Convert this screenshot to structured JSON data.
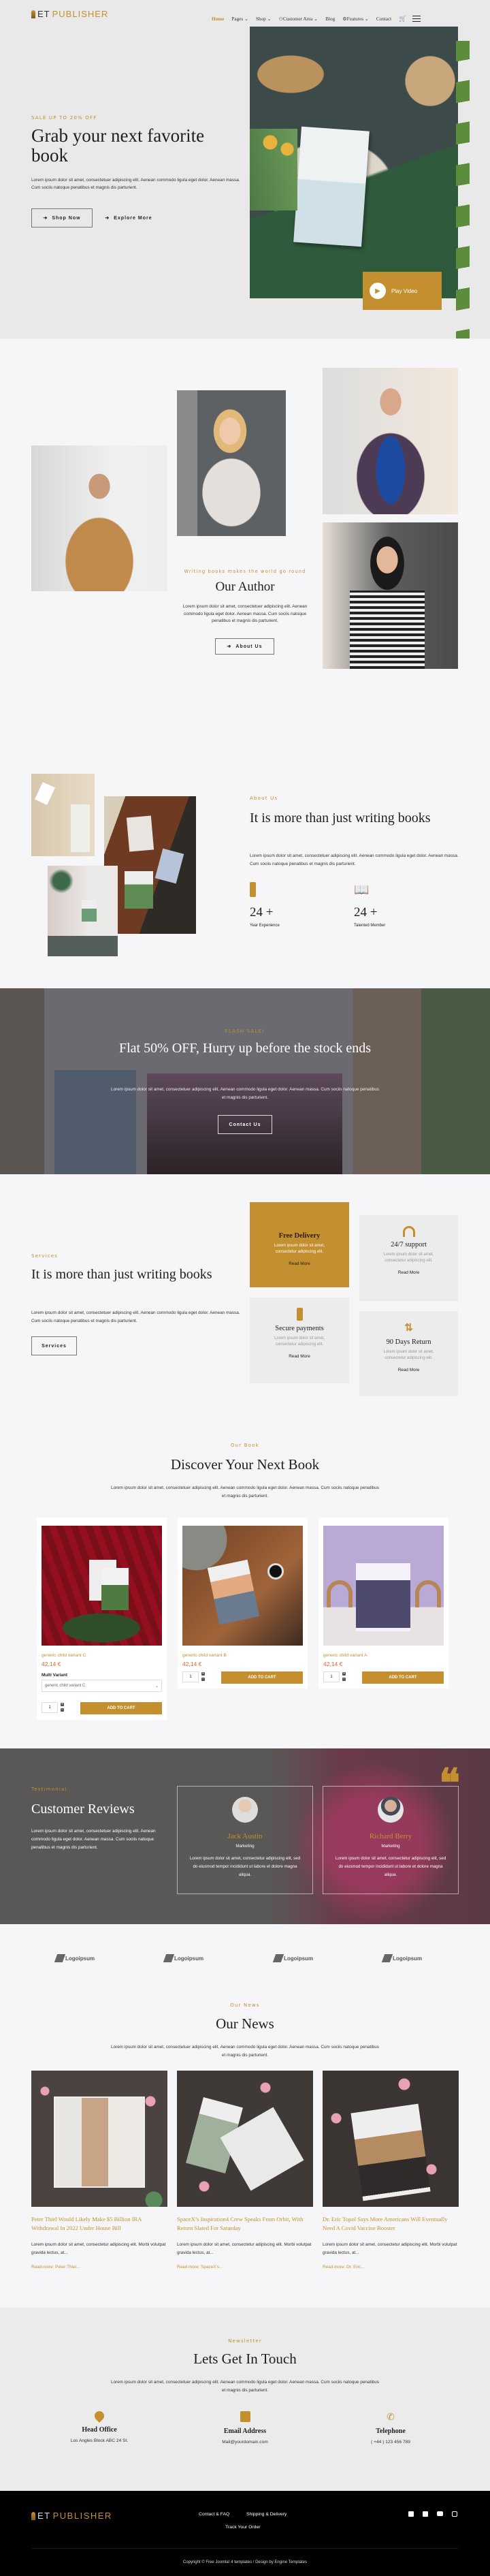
{
  "brand": {
    "logo_prefix": "ET",
    "logo_name": "PUBLISHER",
    "accent": "#c48f2f"
  },
  "nav": {
    "items": [
      {
        "label": "Home",
        "active": true
      },
      {
        "label": "Pages",
        "dropdown": true
      },
      {
        "label": "Shop",
        "dropdown": true
      },
      {
        "label": "Customer Area",
        "dropdown": true,
        "icon": "user-icon"
      },
      {
        "label": "Blog"
      },
      {
        "label": "Features",
        "dropdown": true,
        "icon": "gear-icon"
      },
      {
        "label": "Contact"
      }
    ],
    "cart_icon": "cart-icon",
    "menu_icon": "hamburger-icon"
  },
  "hero": {
    "eyebrow": "SALE UP TO 20% OFF",
    "title": "Grab your next favorite book",
    "text": "Lorem ipsum dolor sit amet, consectetuer adipiscing elit. Aenean commodo ligula eget dolor. Aenean massa. Cum sociis natoque penatibus et magnis dis parturient.",
    "primary_button": "Shop Now",
    "secondary_button": "Explore More",
    "video_button": "Play Video"
  },
  "authors": {
    "eyebrow": "Writing books makes the world go round",
    "title": "Our Author",
    "text": "Lorem ipsum dolor sit amet, consectetuer adipiscing elit. Aenean commodo ligula eget dolor. Aenean massa. Cum sociis natoque penatibus et magnis dis parturient.",
    "button": "About Us"
  },
  "about": {
    "eyebrow": "About Us",
    "title": "It is more than just writing books",
    "text": "Lorem ipsum dolor sit amet, consectetuer adipiscing elit. Aenean commodo ligula eget dolor. Aenean massa. Cum sociis natoque penatibus et magnis dis parturient.",
    "stats": [
      {
        "value": "24 +",
        "label": "Year Experience",
        "icon": "id-badge-icon"
      },
      {
        "value": "24 +",
        "label": "Talented Member",
        "icon": "reader-icon"
      }
    ]
  },
  "flash": {
    "eyebrow": "FLASH SALE!",
    "title": "Flat 50% OFF, Hurry up before the stock ends",
    "text": "Lorem ipsum dolor sit amet, consectetuer adipiscing elit. Aenean commodo ligula eget dolor. Aenean massa. Cum sociis natoque penatibus et magnis dis parturient.",
    "button": "Contact Us"
  },
  "services": {
    "eyebrow": "Services",
    "title": "It is more than just writing books",
    "text": "Lorem ipsum dolor sit amet, consectetuer adipiscing elit. Aenean commodo ligula eget dolor. Aenean massa. Cum sociis natoque penatibus et magnis dis parturient.",
    "button": "Services",
    "cards": [
      {
        "title": "Free Delivery",
        "text": "Lorem ipsum dolor sit amet, consectetur adipiscing elit.",
        "link": "Read More",
        "icon": "truck-icon"
      },
      {
        "title": "24/7 support",
        "text": "Lorem ipsum dolor sit amet, consectetur adipiscing elit.",
        "link": "Read More",
        "icon": "headphones-icon"
      },
      {
        "title": "Secure payments",
        "text": "Lorem ipsum dolor sit amet, consectetur adipiscing elit.",
        "link": "Read More",
        "icon": "phone-icon"
      },
      {
        "title": "90 Days Return",
        "text": "Lorem ipsum dolor sit amet, consectetur adipiscing elit.",
        "link": "Read More",
        "icon": "retweet-icon"
      }
    ]
  },
  "books": {
    "eyebrow": "Our Book",
    "title": "Discover Your Next Book",
    "text": "Lorem ipsum dolor sit amet, consectetuer adipiscing elit. Aenean commodo ligula eget dolor. Aenean massa. Cum sociis natoque penatibus et magnis dis parturient.",
    "products": [
      {
        "name": "generic child variant C",
        "price": "42,14 €",
        "variant_label": "Multi Variant",
        "variant_value": "generic child variant C",
        "qty": "1",
        "button": "ADD TO CART"
      },
      {
        "name": "generic child variant B",
        "price": "42,14 €",
        "qty": "1",
        "button": "ADD TO CART"
      },
      {
        "name": "generic child variant A",
        "price": "42,14 €",
        "qty": "1",
        "button": "ADD TO CART"
      }
    ]
  },
  "testimonials": {
    "eyebrow": "Testimonial",
    "title": "Customer Reviews",
    "text": "Lorem ipsum dolor sit amet, consectetuer adipiscing elit. Aenean commodo ligula eget dolor. Aenean massa. Cum sociis natoque penatibus et magnis dis parturient.",
    "items": [
      {
        "name": "Jack Austin",
        "role": "Marketing",
        "text": "Lorem ipsum dolor sit amet, consectetur adipiscing elit, sed do eiusmod tempor incididunt ut labore et dolore magna aliqua."
      },
      {
        "name": "Richard Berry",
        "role": "Marketing",
        "text": "Lorem ipsum dolor sit amet, consectetur adipiscing elit, sed do eiusmod tempor incididunt ut labore et dolore magna aliqua."
      }
    ]
  },
  "partners": [
    "Logoipsum",
    "Logoipsum",
    "Logoipsum",
    "Logoipsum"
  ],
  "news": {
    "eyebrow": "Our News",
    "title": "Our News",
    "text": "Lorem ipsum dolor sit amet, consectetuer adipiscing elit. Aenean commodo ligula eget dolor. Aenean massa. Cum sociis natoque penatibus et magnis dis parturient.",
    "posts": [
      {
        "title": "Peter Thiel Would Likely Make $5 Billion IRA Withdrawal In 2022 Under House Bill",
        "excerpt": "Lorem ipsum dolor sit amet, consectetur adipiscing elit. Morbi volutpat gravida lectus, at...",
        "link": "Read more: Peter Thiel..."
      },
      {
        "title": "SpaceX’s Inspiration4 Crew Speaks From Orbit, With Return Slated For Saturday",
        "excerpt": "Lorem ipsum dolor sit amet, consectetur adipiscing elit. Morbi volutpat gravida lectus, at...",
        "link": "Read more: SpaceX’s..."
      },
      {
        "title": "Dr. Eric Topol Says More Americans Will Eventually Need A Covid Vaccine Booster",
        "excerpt": "Lorem ipsum dolor sit amet, consectetur adipiscing elit. Morbi volutpat gravida lectus, at...",
        "link": "Read more: Dr. Eric..."
      }
    ]
  },
  "contact": {
    "eyebrow": "Newsletter",
    "title": "Lets Get In Touch",
    "text": "Lorem ipsum dolor sit amet, consectetuer adipiscing elit. Aenean commodo ligula eget dolor. Aenean massa. Cum sociis natoque penatibus et magnis dis parturient.",
    "items": [
      {
        "title": "Head Office",
        "value": "Los Angles Block ABC 24 St.",
        "icon": "map-pin-icon"
      },
      {
        "title": "Email Address",
        "value": "Mail@yourdomain.com",
        "icon": "envelope-icon"
      },
      {
        "title": "Telephone",
        "value": "( +44 ) 123 456 789",
        "icon": "phone-ring-icon"
      }
    ]
  },
  "footer": {
    "links": [
      "Contact & FAQ",
      "Shipping & Delivery",
      "Track Your Order"
    ],
    "social": [
      "facebook-icon",
      "tiktok-icon",
      "youtube-icon",
      "instagram-icon"
    ],
    "copyright": "Copyright © Free Joomla! 4 templates / Design by Engine Templates"
  }
}
